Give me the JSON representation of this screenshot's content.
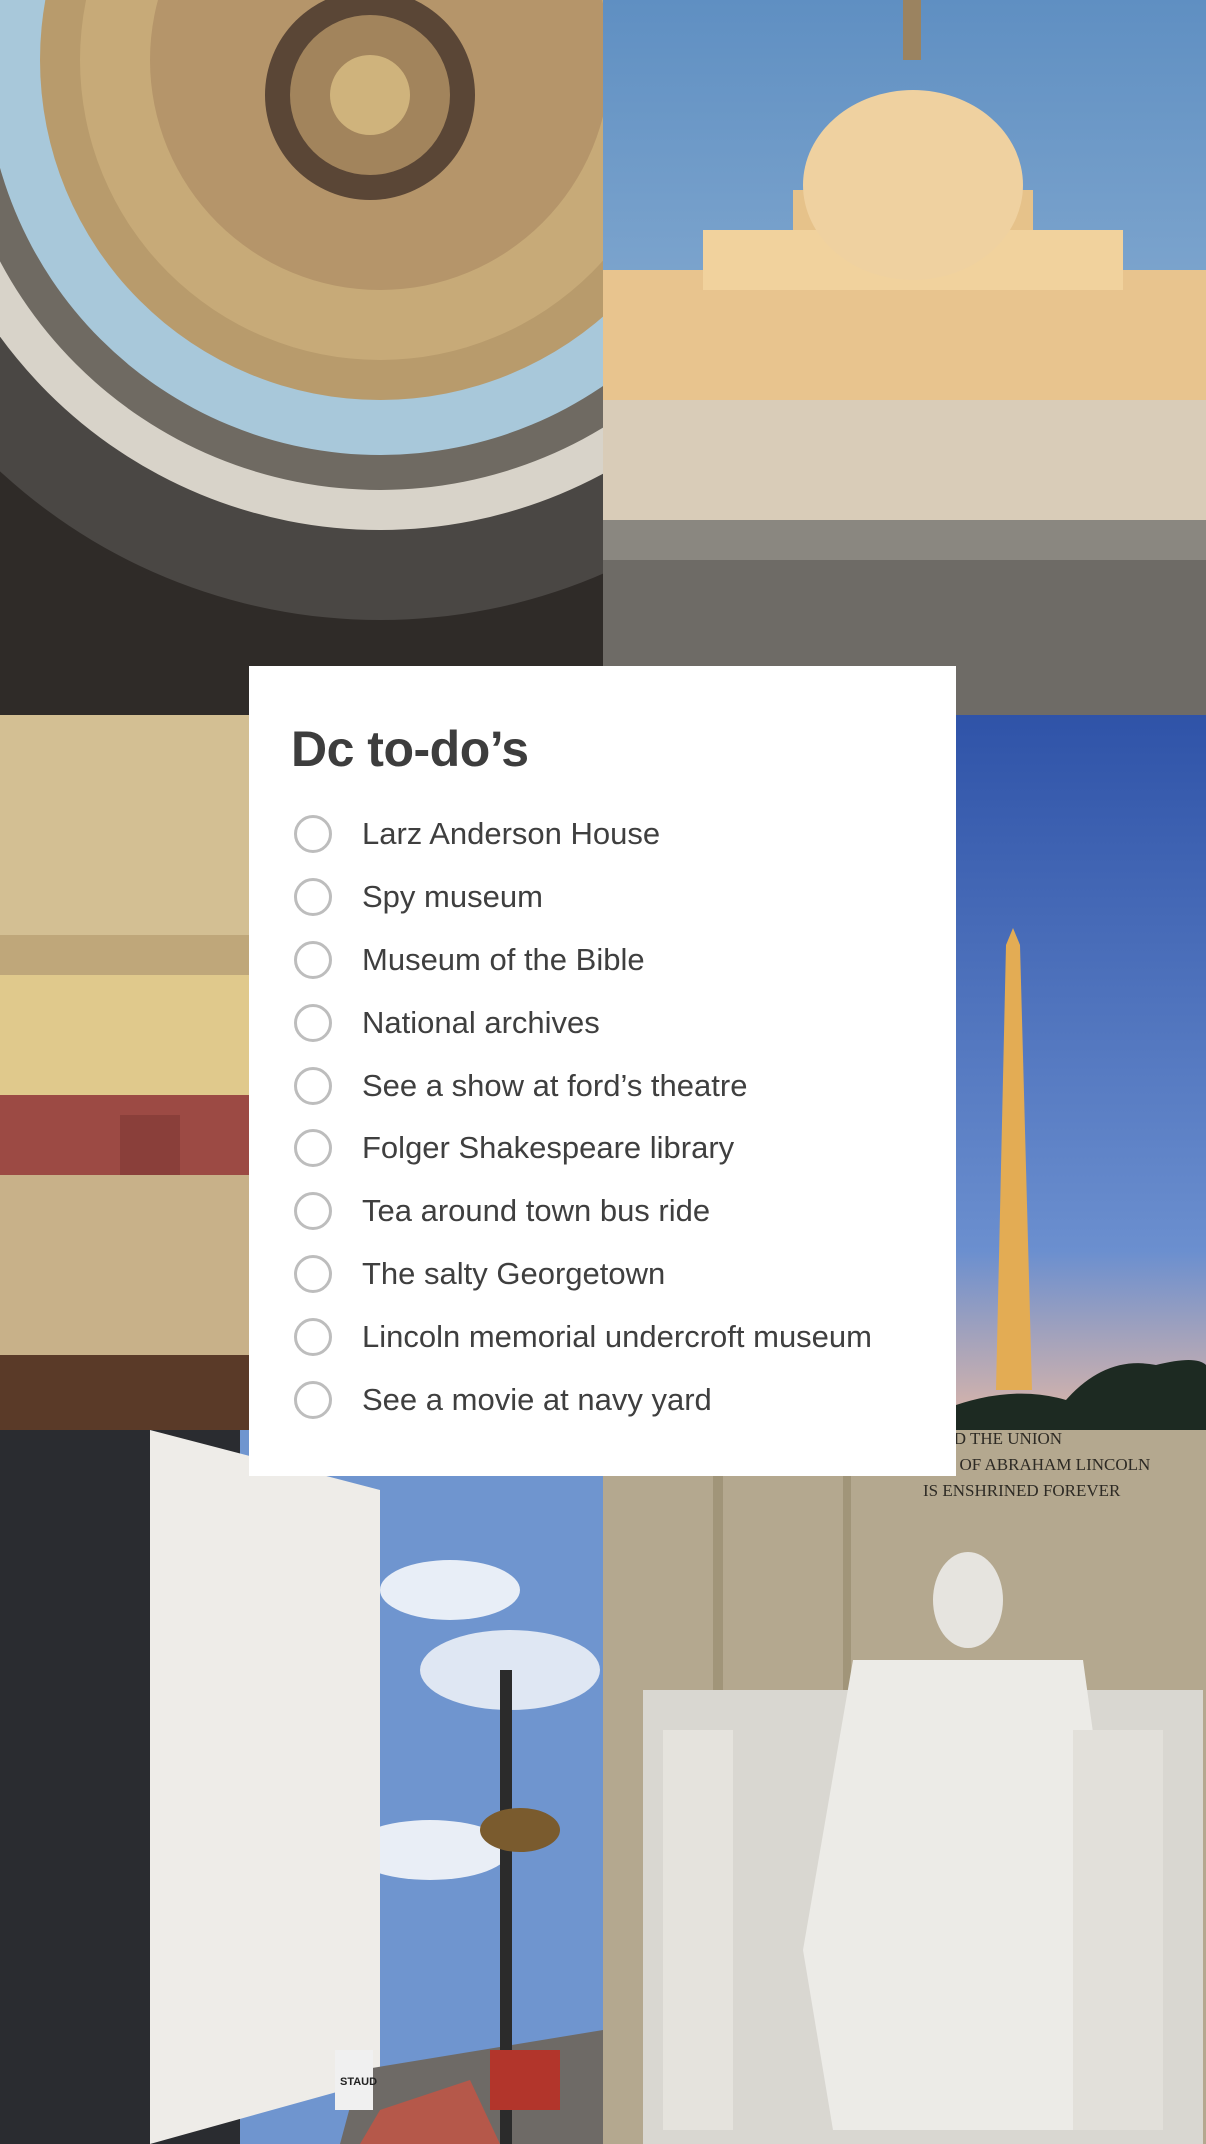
{
  "note": {
    "title": "Dc to-do’s",
    "items": [
      {
        "label": "Larz Anderson House",
        "checked": false
      },
      {
        "label": "Spy museum",
        "checked": false
      },
      {
        "label": "Museum of the Bible",
        "checked": false
      },
      {
        "label": "National archives",
        "checked": false
      },
      {
        "label": "See a show at ford’s theatre",
        "checked": false
      },
      {
        "label": "Folger Shakespeare library",
        "checked": false
      },
      {
        "label": "Tea around town bus ride",
        "checked": false
      },
      {
        "label": "The salty Georgetown",
        "checked": false
      },
      {
        "label": "Lincoln memorial undercroft museum",
        "checked": false
      },
      {
        "label": "See a movie at navy yard",
        "checked": false
      }
    ]
  },
  "photos": {
    "lincoln_inscription": [
      "OM HE SAVED THE UNION",
      "THE MEMORY OF ABRAHAM LINCOLN",
      "IS ENSHRINED FOREVER"
    ],
    "shop_sign": "STAUD"
  },
  "colors": {
    "card_background": "#ffffff",
    "title": "#3d3d3d",
    "text": "#3f3f3f",
    "checkbox_outline": "#bdbdbd"
  }
}
